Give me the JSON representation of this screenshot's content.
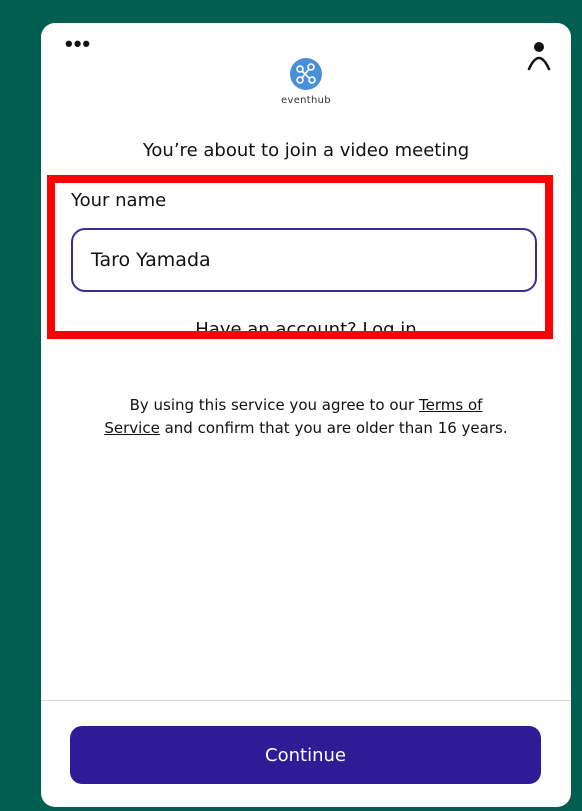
{
  "header": {
    "menu_icon": "more-dots-icon",
    "user_icon": "user-icon",
    "brand": {
      "logo_icon": "eventhub-logo-icon",
      "name": "eventhub",
      "color": "#4a90d9"
    }
  },
  "main": {
    "title": "You’re about to join a video meeting",
    "name_field": {
      "label": "Your name",
      "value": "Taro Yamada",
      "border_color": "#3a2d8f"
    },
    "account_link": "Have an account? Log in",
    "terms": {
      "prefix": "By using this service you agree to our ",
      "link": "Terms of Service",
      "suffix": " and confirm that you are older than 16 years."
    }
  },
  "footer": {
    "continue_label": "Continue",
    "button_color": "#2f1b96"
  },
  "annotation": {
    "highlight_color": "#ff0000"
  },
  "colors": {
    "background": "#005f4f",
    "card": "#ffffff"
  }
}
